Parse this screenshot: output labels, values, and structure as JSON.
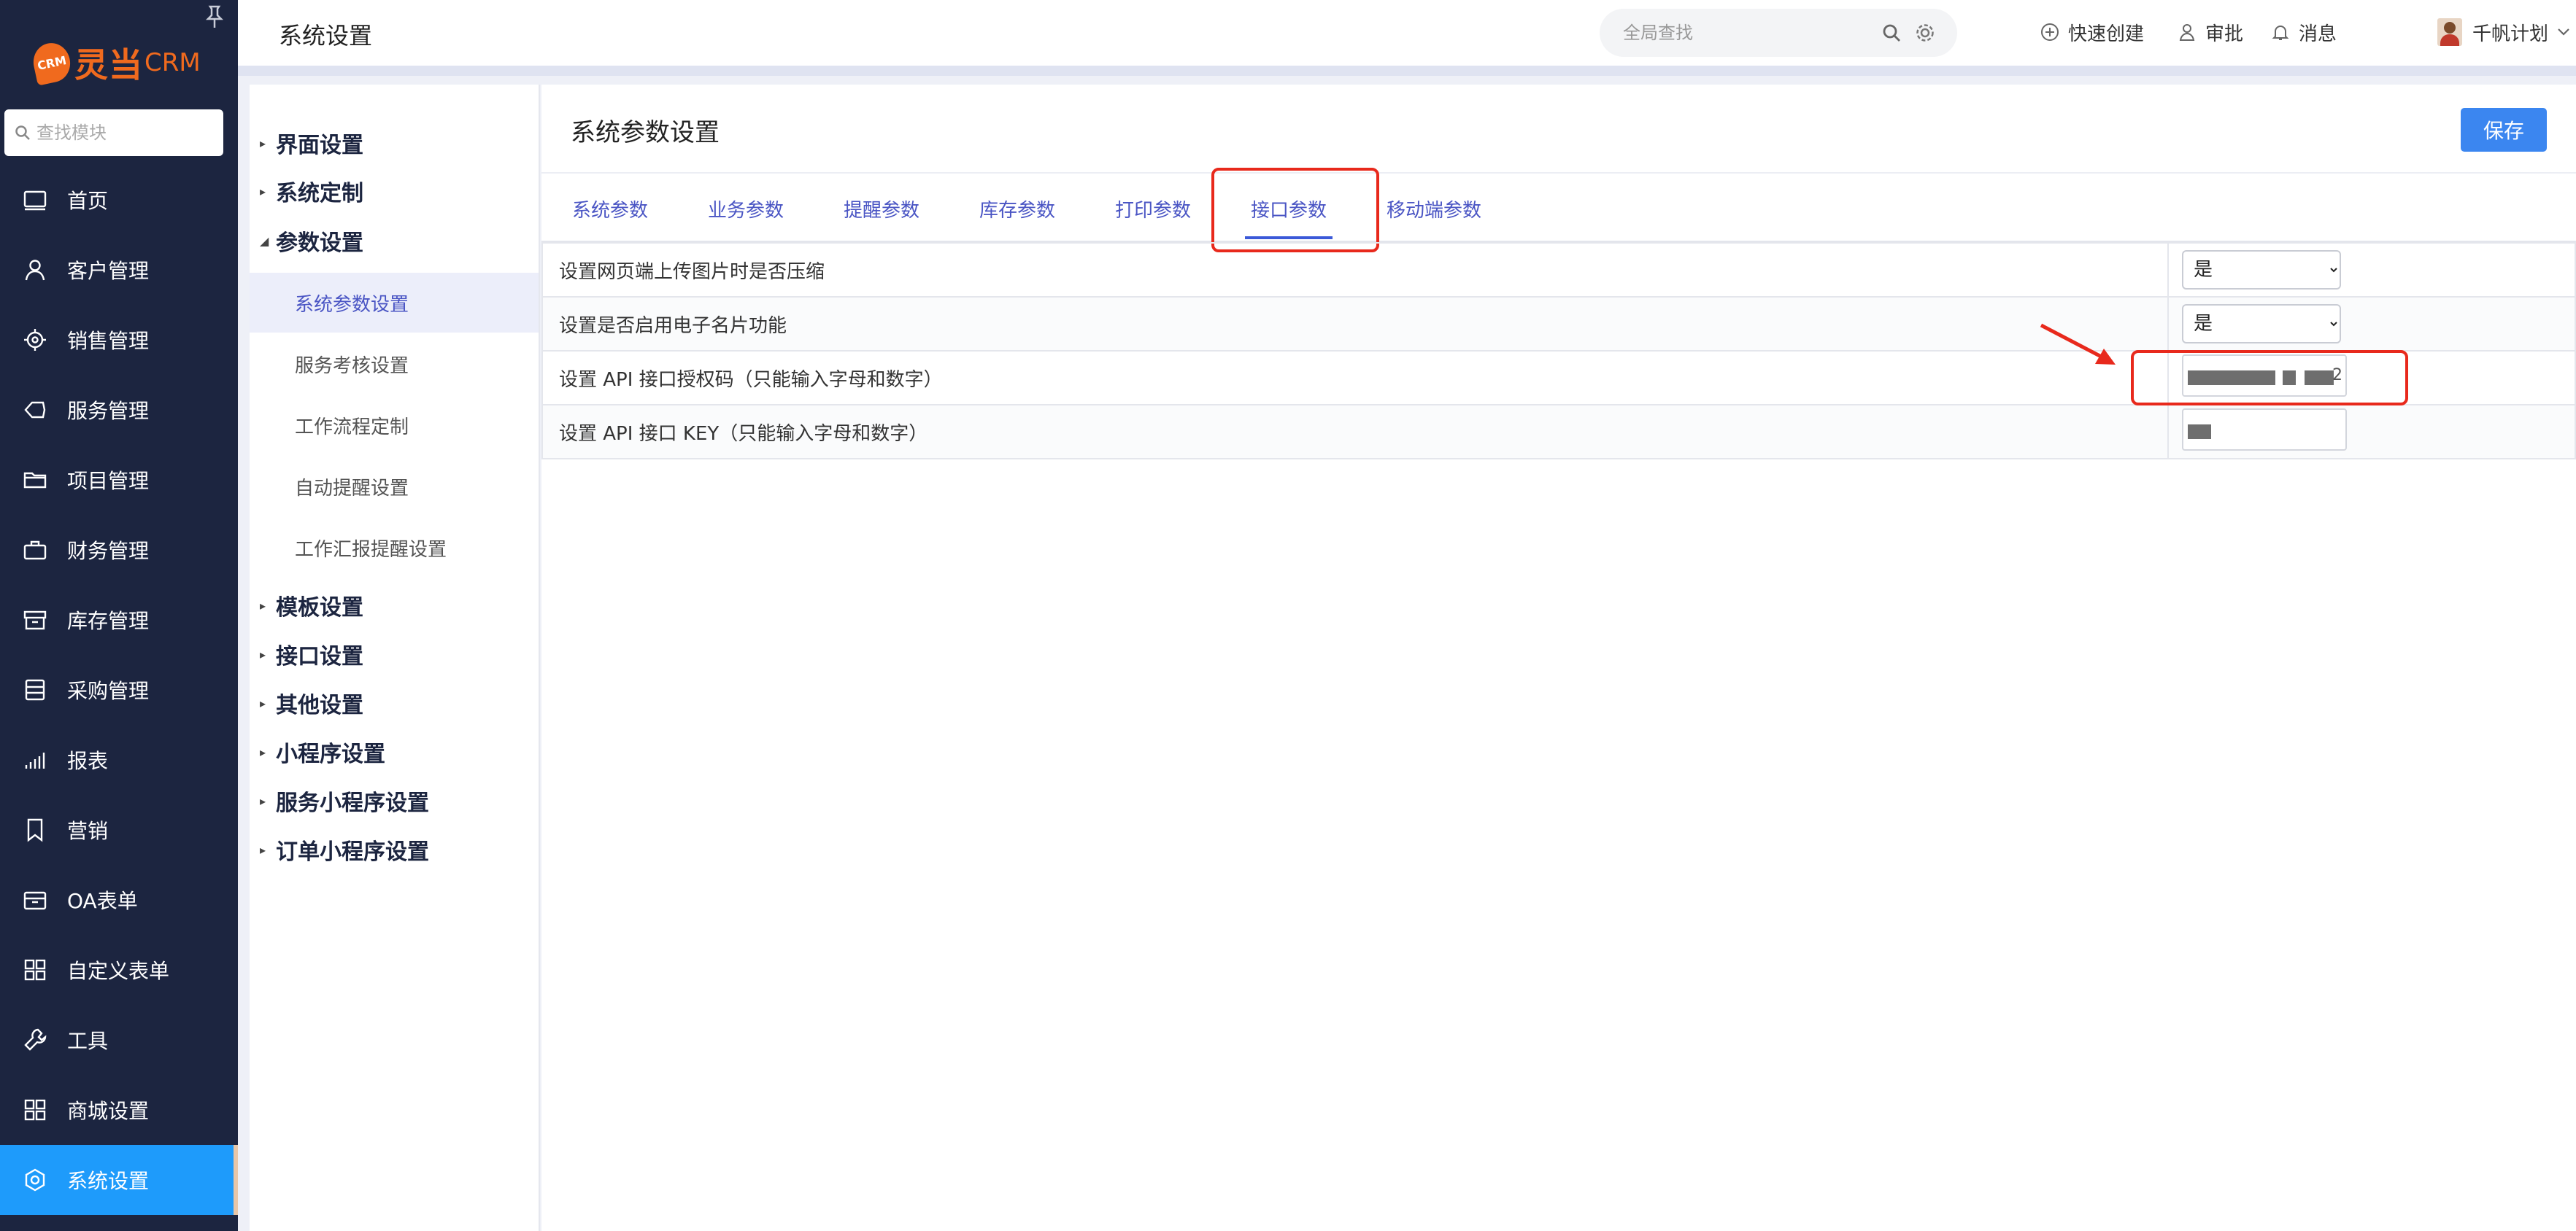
{
  "app": {
    "logo_mark": "CRM",
    "logo_name": "灵当",
    "logo_crm": "CRM",
    "module_search_placeholder": "查找模块",
    "accent_color": "#1e9bfb",
    "sidebar_color": "#1c2540"
  },
  "sidebar": {
    "items": [
      {
        "label": "首页",
        "icon": "monitor-icon"
      },
      {
        "label": "客户管理",
        "icon": "user-icon"
      },
      {
        "label": "销售管理",
        "icon": "target-icon"
      },
      {
        "label": "服务管理",
        "icon": "tag-icon"
      },
      {
        "label": "项目管理",
        "icon": "folder-icon"
      },
      {
        "label": "财务管理",
        "icon": "briefcase-icon"
      },
      {
        "label": "库存管理",
        "icon": "archive-icon"
      },
      {
        "label": "采购管理",
        "icon": "list-icon"
      },
      {
        "label": "报表",
        "icon": "bar-chart-icon"
      },
      {
        "label": "营销",
        "icon": "bookmark-icon"
      },
      {
        "label": "OA表单",
        "icon": "inbox-icon"
      },
      {
        "label": "自定义表单",
        "icon": "grid-icon"
      },
      {
        "label": "工具",
        "icon": "wrench-icon"
      },
      {
        "label": "商城设置",
        "icon": "grid-icon"
      },
      {
        "label": "系统设置",
        "icon": "settings-icon"
      }
    ],
    "active_index": 14
  },
  "header": {
    "title": "系统设置",
    "search_placeholder": "全局查找",
    "quick_create": "快速创建",
    "approval": "审批",
    "messages": "消息",
    "user_name": "千帆计划"
  },
  "submenu": {
    "groups_top": [
      "界面设置",
      "系统定制",
      "参数设置"
    ],
    "param_children": [
      "系统参数设置",
      "服务考核设置",
      "工作流程定制",
      "自动提醒设置",
      "工作汇报提醒设置"
    ],
    "groups_bottom": [
      "模板设置",
      "接口设置",
      "其他设置",
      "小程序设置",
      "服务小程序设置",
      "订单小程序设置"
    ]
  },
  "panel": {
    "title": "系统参数设置",
    "save_label": "保存",
    "tabs": [
      "系统参数",
      "业务参数",
      "提醒参数",
      "库存参数",
      "打印参数",
      "接口参数",
      "移动端参数"
    ],
    "active_tab": "接口参数"
  },
  "params": [
    {
      "label": "设置网页端上传图片时是否压缩",
      "type": "select",
      "value": "是"
    },
    {
      "label": "设置是否启用电子名片功能",
      "type": "select",
      "value": "是"
    },
    {
      "label": "设置 API 接口授权码（只能输入字母和数字）",
      "type": "masked",
      "tail": "2"
    },
    {
      "label": "设置 API 接口 KEY（只能输入字母和数字）",
      "type": "masked",
      "tail": ""
    }
  ],
  "highlight_color": "#e8291c"
}
